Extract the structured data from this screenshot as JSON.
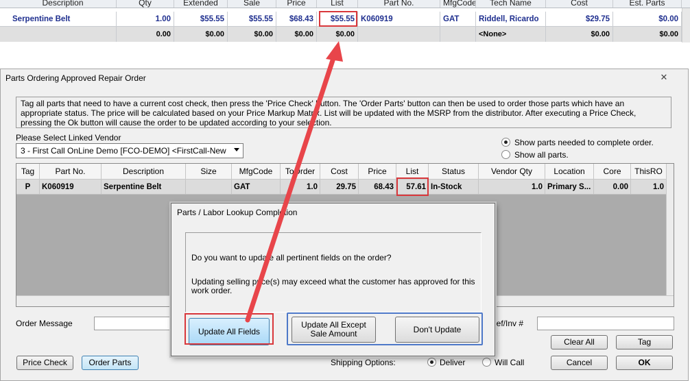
{
  "top_grid": {
    "headers": [
      "Description",
      "Qty",
      "Extended",
      "Sale",
      "Price",
      "List",
      "Part No.",
      "MfgCode",
      "Tech Name",
      "Cost",
      "Est. Parts"
    ],
    "row1": [
      "Serpentine Belt",
      "1.00",
      "$55.55",
      "$55.55",
      "$68.43",
      "$55.55",
      "K060919",
      "GAT",
      "Riddell, Ricardo",
      "$29.75",
      "$0.00"
    ],
    "row2": [
      "",
      "0.00",
      "$0.00",
      "$0.00",
      "$0.00",
      "$0.00",
      "",
      "",
      "<None>",
      "$0.00",
      "$0.00"
    ]
  },
  "window": {
    "title": "Parts Ordering Approved Repair Order",
    "close_glyph": "✕",
    "instructions": "Tag all parts that need to have a current cost check, then press the 'Price Check' button.  The 'Order Parts' button can then be used to order those parts which have an appropriate status.  The price will be calculated based on your Price Markup Matrix. List will be updated with the MSRP from the distributor.  After executing a Price Check, pressing the Ok button will cause the order to be updated according to your selection.",
    "vendor_label": "Please Select Linked Vendor",
    "vendor_value": "3 - First Call OnLine Demo [FCO-DEMO] <FirstCall-New",
    "radio_needed": "Show parts needed to complete order.",
    "radio_all": "Show all parts.",
    "grid_headers": [
      "Tag",
      "Part No.",
      "Description",
      "Size",
      "MfgCode",
      "ToOrder",
      "Cost",
      "Price",
      "List",
      "Status",
      "Vendor Qty",
      "Location",
      "Core",
      "ThisRO"
    ],
    "grid_row": [
      "P",
      "K060919",
      "Serpentine Belt",
      "",
      "GAT",
      "1.0",
      "29.75",
      "68.43",
      "57.61",
      "In-Stock",
      "1.0",
      "Primary S...",
      "0.00",
      "1.0"
    ],
    "order_message_label": "Order Message",
    "ref_inv_label": "Ref/Inv #",
    "price_check": "Price Check",
    "order_parts": "Order Parts",
    "shipping_label": "Shipping Options:",
    "deliver": "Deliver",
    "will_call": "Will Call",
    "clear_all": "Clear All",
    "tag": "Tag",
    "cancel": "Cancel",
    "ok": "OK"
  },
  "dialog": {
    "title": "Parts / Labor Lookup Completion",
    "question": "Do you want to update all pertinent fields on the order?",
    "warning": "Updating selling price(s) may exceed what the customer has approved for this work order.",
    "update_all": "Update All Fields",
    "update_except_line1": "Update All Except",
    "update_except_line2": "Sale Amount",
    "dont_update": "Don't Update"
  },
  "colors": {
    "highlight_red": "#d9373b",
    "highlight_blue": "#4d78c8",
    "arrow_red": "#e8454a",
    "link_blue": "#1f2f8f",
    "focused_button": "#bfe3fb"
  }
}
